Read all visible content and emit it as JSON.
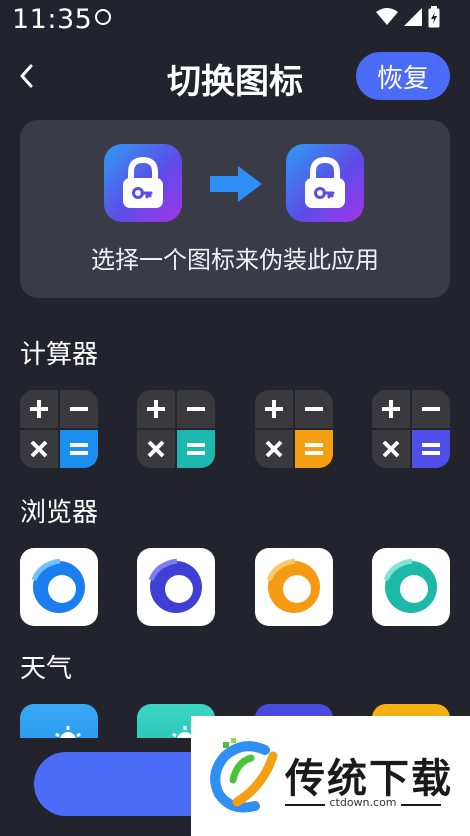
{
  "status_bar": {
    "time": "11:35"
  },
  "header": {
    "title": "切换图标",
    "restore_label": "恢复"
  },
  "preview": {
    "caption": "选择一个图标来伪装此应用"
  },
  "sections": {
    "calculator": {
      "title": "计算器",
      "accent_colors": [
        "#1a8ff0",
        "#1cb8b0",
        "#f5a012",
        "#4f4fe8"
      ]
    },
    "browser": {
      "title": "浏览器"
    },
    "weather": {
      "title": "天气"
    }
  },
  "watermark": {
    "brand": "传统下载",
    "domain": "ctdown.com"
  },
  "colors": {
    "background": "#22232d",
    "card": "#393b47",
    "accent": "#4b6cf6"
  }
}
